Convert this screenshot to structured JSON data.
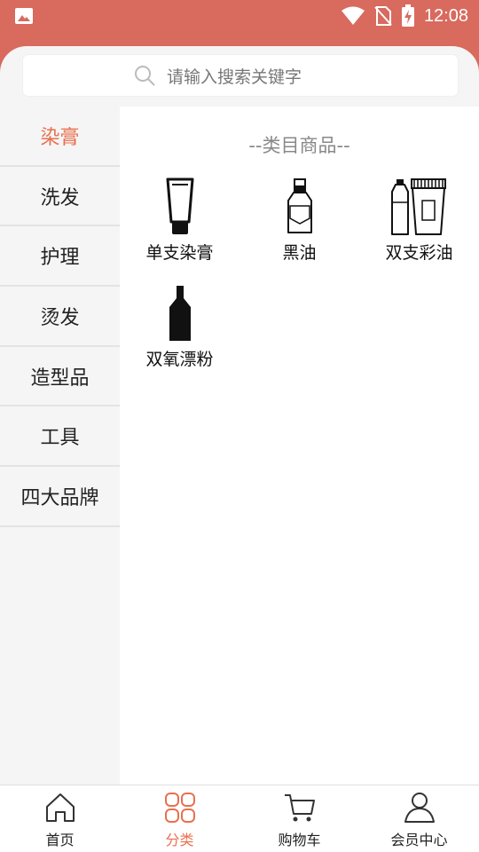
{
  "status_bar": {
    "time": "12:08"
  },
  "search": {
    "placeholder": "请输入搜索关键字"
  },
  "categories": [
    {
      "label": "染膏",
      "active": true
    },
    {
      "label": "洗发"
    },
    {
      "label": "护理"
    },
    {
      "label": "烫发"
    },
    {
      "label": "造型品"
    },
    {
      "label": "工具"
    },
    {
      "label": "四大品牌"
    }
  ],
  "panel": {
    "title": "--类目商品--",
    "products": [
      {
        "label": "单支染膏",
        "icon": "tube-icon"
      },
      {
        "label": "黑油",
        "icon": "bottle-icon"
      },
      {
        "label": "双支彩油",
        "icon": "bottle-and-tube-icon"
      },
      {
        "label": "双氧漂粉",
        "icon": "black-bottle-icon"
      }
    ]
  },
  "tabs": [
    {
      "label": "首页",
      "icon": "home-icon"
    },
    {
      "label": "分类",
      "icon": "category-icon",
      "active": true
    },
    {
      "label": "购物车",
      "icon": "cart-icon"
    },
    {
      "label": "会员中心",
      "icon": "user-icon"
    }
  ],
  "colors": {
    "accent": "#e9704f",
    "header": "#d96a5e"
  }
}
